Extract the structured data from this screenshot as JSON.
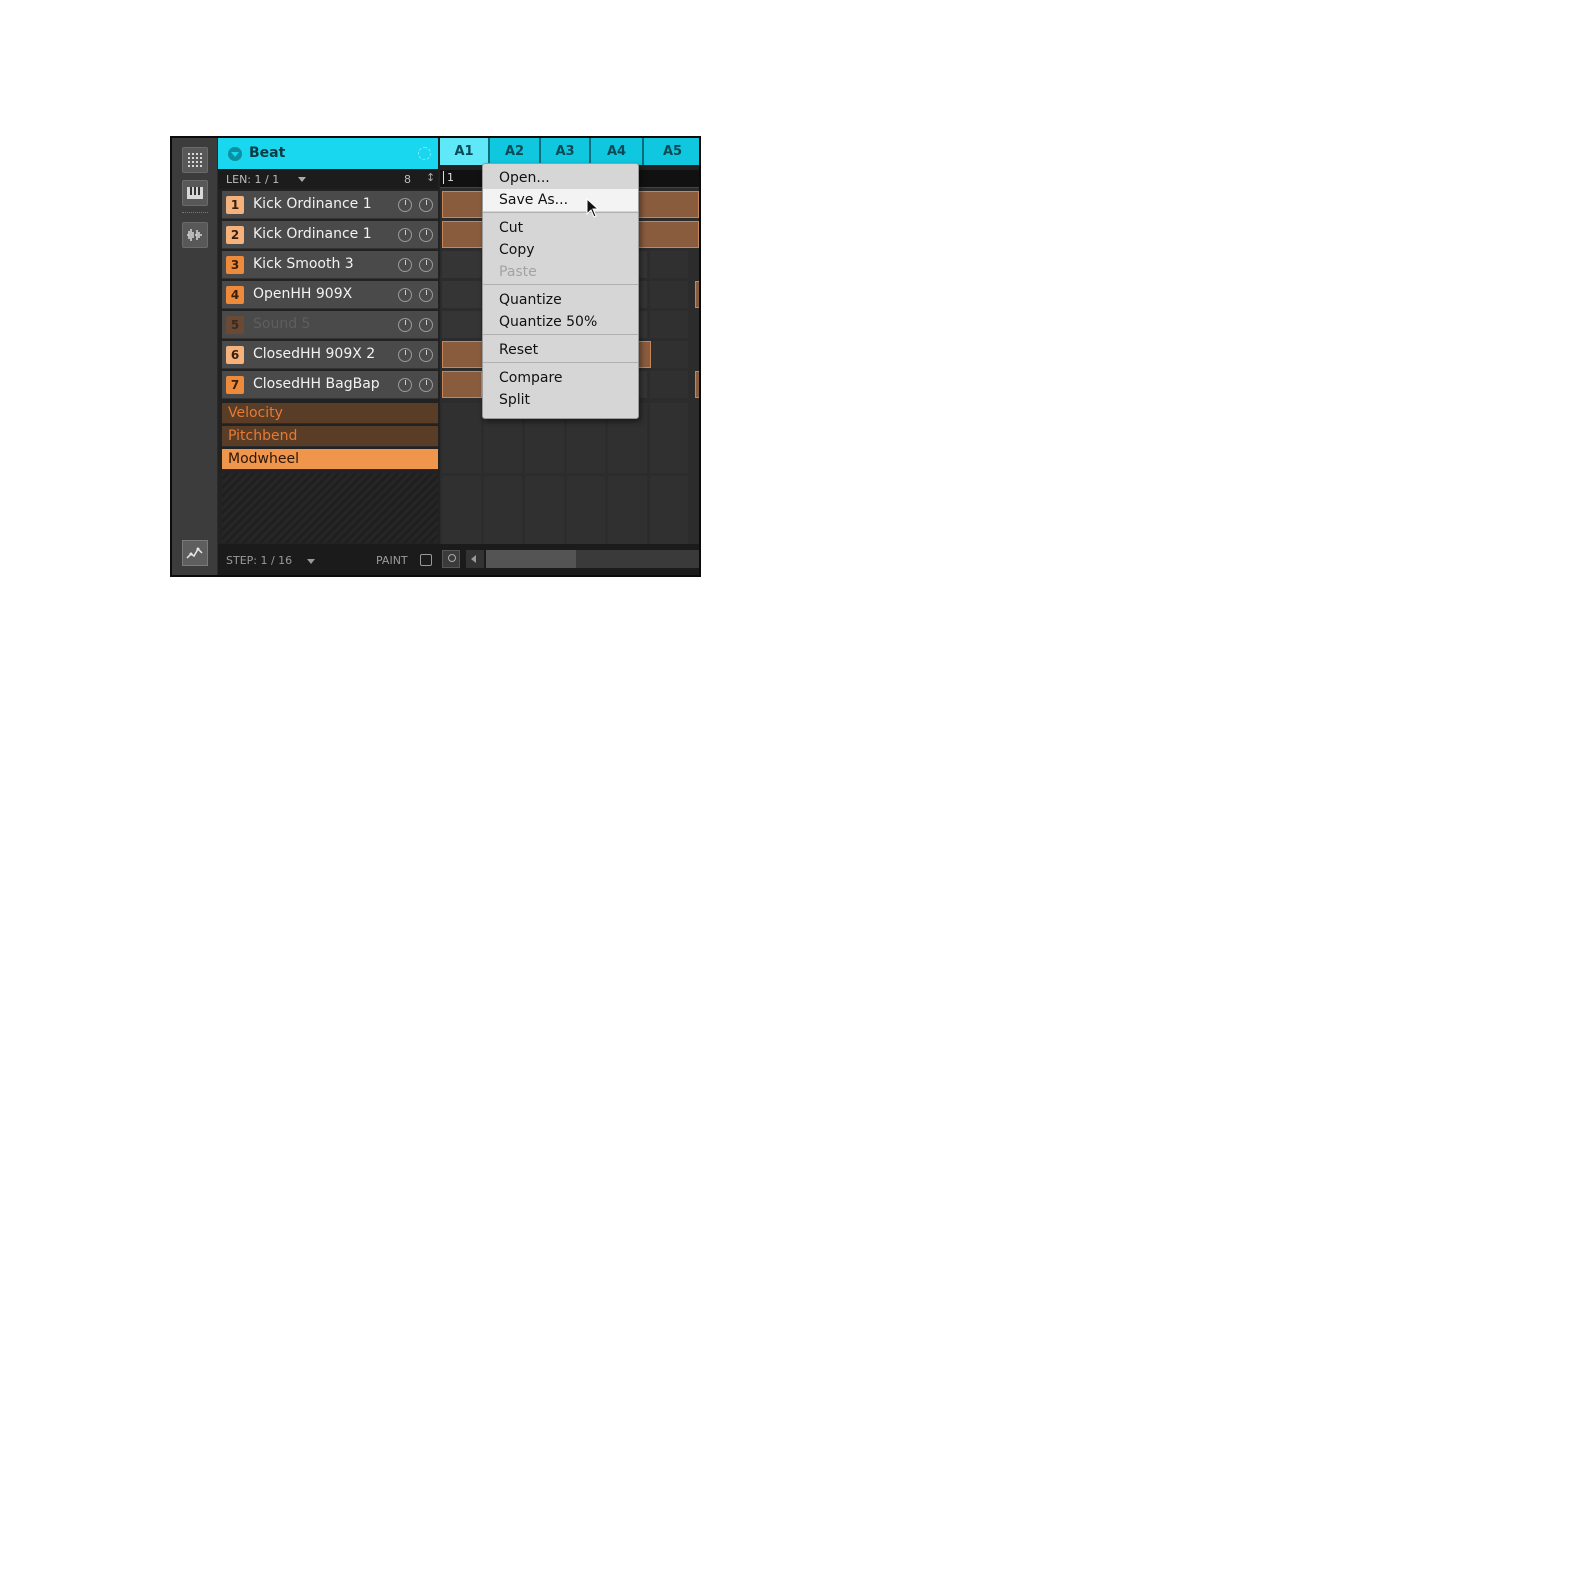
{
  "group": {
    "title": "Beat"
  },
  "patterns": [
    "A1",
    "A2",
    "A3",
    "A4",
    "A5"
  ],
  "active_pattern": "A1",
  "length": {
    "label": "LEN: 1 / 1",
    "value": "8",
    "ruler_start": "1"
  },
  "sounds": [
    {
      "num": "1",
      "name": "Kick Ordinance 1",
      "color": "#f5b27d",
      "dim": false
    },
    {
      "num": "2",
      "name": "Kick Ordinance 1",
      "color": "#f5b27d",
      "dim": false
    },
    {
      "num": "3",
      "name": "Kick Smooth 3",
      "color": "#ee8a3c",
      "dim": false
    },
    {
      "num": "4",
      "name": "OpenHH 909X",
      "color": "#ee8a3c",
      "dim": false
    },
    {
      "num": "5",
      "name": "Sound 5",
      "color": "#6a4a34",
      "dim": true
    },
    {
      "num": "6",
      "name": "ClosedHH 909X 2",
      "color": "#f5b27d",
      "dim": false
    },
    {
      "num": "7",
      "name": "ClosedHH BagBap",
      "color": "#ee8a3c",
      "dim": false
    }
  ],
  "params": [
    "Velocity",
    "Pitchbend",
    "Modwheel"
  ],
  "selected_param": "Modwheel",
  "footer": {
    "step_label": "STEP: 1 / 16",
    "paint_label": "PAINT"
  },
  "context_menu": {
    "items": [
      {
        "label": "Open...",
        "state": "normal"
      },
      {
        "label": "Save As...",
        "state": "hover"
      },
      {
        "label": "Cut",
        "state": "normal"
      },
      {
        "label": "Copy",
        "state": "normal"
      },
      {
        "label": "Paste",
        "state": "disabled"
      },
      {
        "label": "Quantize",
        "state": "normal"
      },
      {
        "label": "Quantize 50%",
        "state": "normal"
      },
      {
        "label": "Reset",
        "state": "normal"
      },
      {
        "label": "Compare",
        "state": "normal"
      },
      {
        "label": "Split",
        "state": "normal"
      }
    ]
  },
  "colors": {
    "accent": "#19d7ef",
    "note": "#8a5c3e",
    "param_selected": "#f0954c"
  }
}
